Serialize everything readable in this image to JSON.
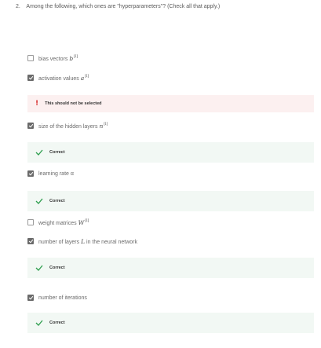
{
  "question": {
    "number": "2.",
    "text": "Among the following, which ones are \"hyperparameters\"? (Check all that apply.)"
  },
  "options": [
    {
      "label": "bias vectors",
      "math": "b",
      "sup": "[l]"
    },
    {
      "label": "activation values",
      "math": "a",
      "sup": "[l]"
    },
    {
      "label": "size of the hidden layers",
      "math": "n",
      "sup": "[l]"
    },
    {
      "label": "learning rate α"
    },
    {
      "label": "weight matrices",
      "math": "W",
      "sup": "[l]"
    },
    {
      "label": "number of layers",
      "math": "L",
      "suffix": "in the neural network"
    },
    {
      "label": "number of iterations"
    }
  ],
  "feedback": {
    "wrong": "This should not be selected",
    "correct": "Correct"
  },
  "colors": {
    "correct_bg": "#f2f8f4",
    "wrong_bg": "#fcf0f0",
    "check_green": "#2e9e4e",
    "error_red": "#d93030"
  }
}
